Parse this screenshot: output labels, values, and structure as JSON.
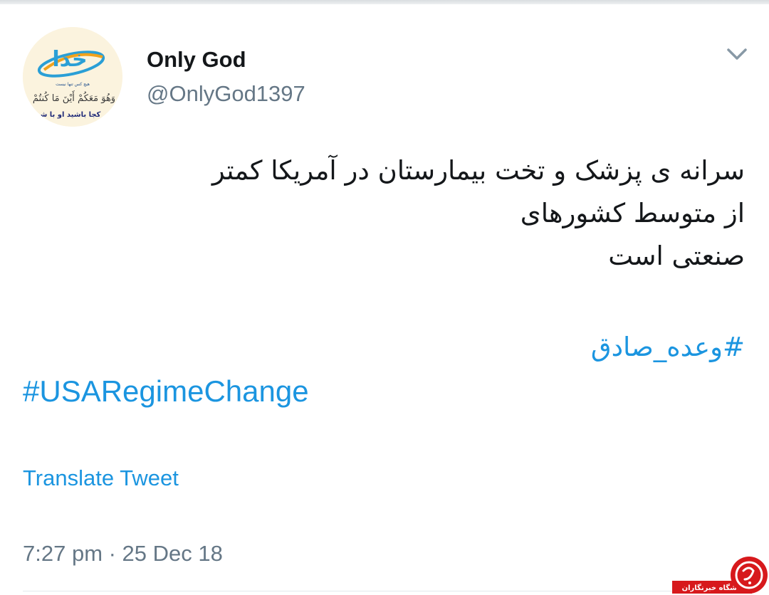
{
  "tweet": {
    "display_name": "Only God",
    "handle": "@OnlyGod1397",
    "text_lines": [
      "سرانه ی پزشک و تخت بیمارستان در آمریکا کمتر",
      "از متوسط کشورهای",
      "صنعتی است"
    ],
    "hashtags": [
      "#وعده_صادق",
      "#USARegimeChange"
    ],
    "translate_label": "Translate Tweet",
    "timestamp": "7:27 pm · 25 Dec 18",
    "menu_icon": "chevron-down-icon"
  },
  "avatar": {
    "logo_text": "خدا",
    "tagline": "هیچ کس تنها نیست",
    "verse": "وَهُوَ مَعَكُمْ أَيْنَ مَا كُنتُمْ",
    "caption": "هر کجا باشید او با شما"
  },
  "watermark": {
    "label": "باشگاه خبرنگاران",
    "brand_color": "#d7191c"
  },
  "colors": {
    "text_primary": "#14171a",
    "text_secondary": "#657786",
    "link": "#1b95e0"
  }
}
